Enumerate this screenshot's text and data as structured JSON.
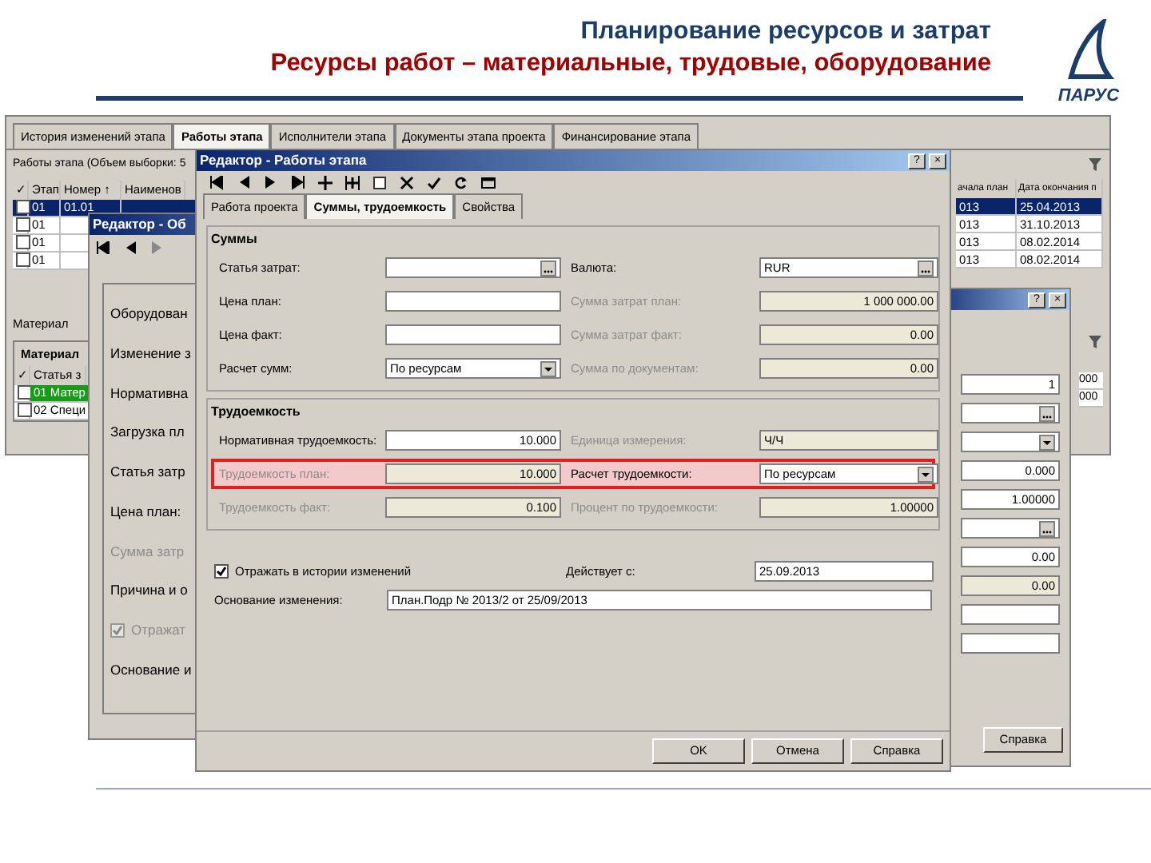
{
  "slide": {
    "title": "Планирование ресурсов и затрат",
    "subtitle": "Ресурсы работ – материальные, трудовые, оборудование",
    "logo_text": "ПАРУС"
  },
  "main_window": {
    "tabs": [
      {
        "label": "История изменений этапа",
        "selected": false
      },
      {
        "label": "Работы этапа",
        "selected": true
      },
      {
        "label": "Исполнители этапа",
        "selected": false
      },
      {
        "label": "Документы этапа проекта",
        "selected": false
      },
      {
        "label": "Финансирование этапа",
        "selected": false
      }
    ],
    "caption": "Работы этапа (Объем выборки: 5",
    "check_header": "✓",
    "columns": [
      "Этап",
      "Номер ↑",
      "Наименов"
    ],
    "rows": [
      {
        "selected": true,
        "checked": false,
        "cells": [
          "01",
          "01.01"
        ]
      },
      {
        "selected": false,
        "checked": false,
        "cells": [
          "01"
        ]
      },
      {
        "selected": false,
        "checked": false,
        "cells": [
          "01"
        ]
      },
      {
        "selected": false,
        "checked": false,
        "cells": [
          "01"
        ]
      }
    ],
    "right_columns": [
      "ачала план",
      "Дата окончания п"
    ],
    "right_rows": [
      {
        "selected": true,
        "cells": [
          "013",
          "25.04.2013"
        ]
      },
      {
        "selected": false,
        "cells": [
          "013",
          "31.10.2013"
        ]
      },
      {
        "selected": false,
        "cells": [
          "013",
          "08.02.2014"
        ]
      },
      {
        "selected": false,
        "cells": [
          "013",
          "08.02.2014"
        ]
      }
    ],
    "detail_caption": "Материал",
    "detail_header": "Материал",
    "detail_check_header": "✓",
    "detail_columns": [
      "Статья з"
    ],
    "detail_rows": [
      {
        "label": "01 Матер",
        "selected": true,
        "checked": false
      },
      {
        "label": "02 Специ",
        "selected": false,
        "checked": false
      }
    ],
    "detail_right_values": [
      "000",
      "000"
    ]
  },
  "dialog_a": {
    "title": "Редактор - Об",
    "items": [
      {
        "kind": "label",
        "text": "Оборудован",
        "disabled": false
      },
      {
        "kind": "label",
        "text": "Изменение з",
        "disabled": false
      },
      {
        "kind": "label",
        "text": "Нормативна",
        "disabled": false
      },
      {
        "kind": "label",
        "text": "Загрузка пл",
        "disabled": false
      },
      {
        "kind": "label",
        "text": "Статья затр",
        "disabled": false
      },
      {
        "kind": "label",
        "text": "Цена план:",
        "disabled": false
      },
      {
        "kind": "label",
        "text": "Сумма затр",
        "disabled": true
      },
      {
        "kind": "label",
        "text": "Причина и о",
        "disabled": false
      },
      {
        "kind": "checkbox",
        "text": "Отражат",
        "disabled": true,
        "checked": true
      },
      {
        "kind": "label",
        "text": "Основание и",
        "disabled": false
      }
    ]
  },
  "dialog_b": {
    "controls": [
      "?",
      "×"
    ],
    "fields": [
      {
        "kind": "number",
        "value": "1",
        "readonly": false
      },
      {
        "kind": "picker",
        "readonly": false
      },
      {
        "kind": "combo",
        "readonly": false
      },
      {
        "kind": "number",
        "value": "0.000",
        "readonly": false
      },
      {
        "kind": "number",
        "value": "1.00000",
        "readonly": false
      },
      {
        "kind": "picker",
        "readonly": false
      },
      {
        "kind": "number",
        "value": "0.00",
        "readonly": false
      },
      {
        "kind": "number",
        "value": "0.00",
        "readonly": true
      },
      {
        "kind": "text",
        "readonly": false
      },
      {
        "kind": "text",
        "readonly": false
      }
    ],
    "buttons": [
      "Справка"
    ]
  },
  "editor": {
    "title": "Редактор - Работы этапа",
    "controls": [
      "?",
      "×"
    ],
    "tabs": [
      {
        "label": "Работа проекта",
        "selected": false
      },
      {
        "label": "Суммы, трудоемкость",
        "selected": true
      },
      {
        "label": "Свойства",
        "selected": false
      }
    ],
    "groups": [
      {
        "title": "Суммы",
        "rows": [
          {
            "highlighted": false,
            "cells": [
              {
                "label": "Статья затрат:",
                "disabled": false,
                "kind": "picker",
                "readonly": false
              },
              {
                "label": "Валюта:",
                "disabled": false,
                "kind": "picker",
                "value": "RUR",
                "readonly": false
              }
            ]
          },
          {
            "highlighted": false,
            "cells": [
              {
                "label": "Цена план:",
                "disabled": false,
                "kind": "text",
                "readonly": false
              },
              {
                "label": "Сумма затрат план:",
                "disabled": true,
                "kind": "number",
                "value": "1 000 000.00",
                "readonly": true
              }
            ]
          },
          {
            "highlighted": false,
            "cells": [
              {
                "label": "Цена факт:",
                "disabled": false,
                "kind": "text",
                "readonly": false
              },
              {
                "label": "Сумма затрат факт:",
                "disabled": true,
                "kind": "number",
                "value": "0.00",
                "readonly": true
              }
            ]
          },
          {
            "highlighted": false,
            "cells": [
              {
                "label": "Расчет сумм:",
                "disabled": false,
                "kind": "combo",
                "value": "По ресурсам",
                "readonly": false
              },
              {
                "label": "Сумма по документам:",
                "disabled": true,
                "kind": "number",
                "value": "0.00",
                "readonly": true
              }
            ]
          }
        ]
      },
      {
        "title": "Трудоемкость",
        "rows": [
          {
            "highlighted": false,
            "cells": [
              {
                "label": "Нормативная трудоемкость:",
                "disabled": false,
                "kind": "number",
                "value": "10.000",
                "readonly": false
              },
              {
                "label": "Единица измерения:",
                "disabled": true,
                "kind": "text",
                "value": "Ч/Ч",
                "readonly": true
              }
            ]
          },
          {
            "highlighted": true,
            "cells": [
              {
                "label": "Трудоемкость план:",
                "disabled": true,
                "kind": "number",
                "value": "10.000",
                "readonly": true
              },
              {
                "label": "Расчет трудоемкости:",
                "disabled": false,
                "kind": "combo",
                "value": "По ресурсам",
                "readonly": false
              }
            ]
          },
          {
            "highlighted": false,
            "cells": [
              {
                "label": "Трудоемкость факт:",
                "disabled": true,
                "kind": "number",
                "value": "0.100",
                "readonly": true
              },
              {
                "label": "Процент по трудоемкости:",
                "disabled": true,
                "kind": "number",
                "value": "1.00000",
                "readonly": true
              }
            ]
          }
        ]
      }
    ],
    "history": {
      "checked": true,
      "label": "Отражать в истории изменений",
      "date_label": "Действует с:",
      "date": "25.09.2013"
    },
    "reason": {
      "label": "Основание изменения:",
      "value": "План.Подр № 2013/2 от 25/09/2013"
    },
    "buttons": [
      "OK",
      "Отмена",
      "Справка"
    ]
  }
}
